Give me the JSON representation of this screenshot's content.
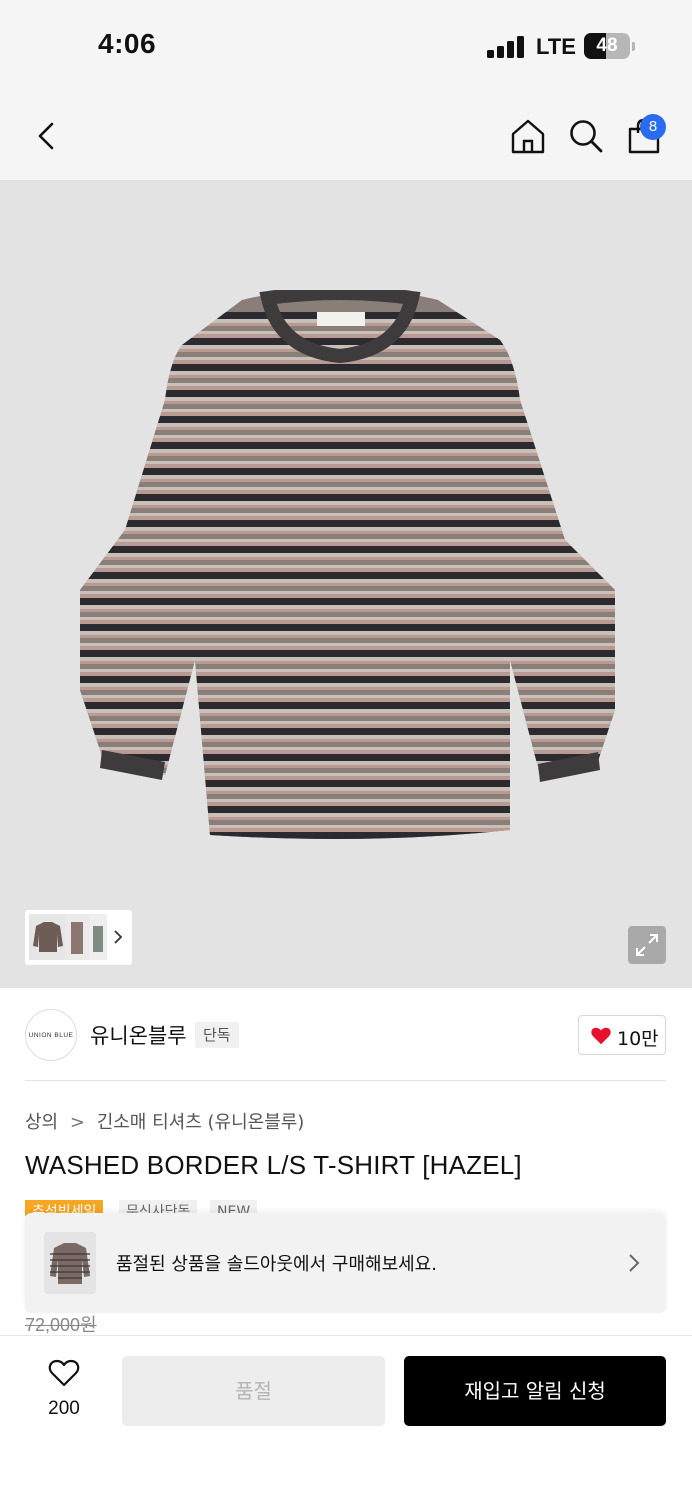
{
  "status_bar": {
    "time": "4:06",
    "network": "LTE",
    "battery": "48",
    "battery_level": 0.48
  },
  "header": {
    "back_icon": "chevron-left-icon",
    "home_icon": "home-icon",
    "search_icon": "search-icon",
    "cart_icon": "shopping-bag-icon",
    "cart_count": "8"
  },
  "gallery": {
    "image": "striped long-sleeve t-shirt",
    "shirt_colors": {
      "base": "#8a7e79",
      "dark_stripe": "#2b2a2f",
      "rose_stripe": "#b89a93",
      "light_stripe": "#c8bfb9",
      "rib": "#3d3b3c"
    },
    "expand_icon": "expand-icon",
    "thumb_more_icon": "chevron-right-icon"
  },
  "brand": {
    "logo_text": "UNION BLUE",
    "name": "유니온블루",
    "tag": "단독",
    "like_icon": "heart-icon",
    "like_count": "10만"
  },
  "breadcrumb": {
    "category": "상의",
    "separator": ">",
    "subcategory": "긴소매 티셔츠 (유니온블루)"
  },
  "product": {
    "title": "WASHED BORDER L/S T-SHIRT [HAZEL]",
    "tags": [
      "추석빅세일",
      "무신사단독",
      "NEW"
    ],
    "original_price": "72,000원"
  },
  "soldout_banner": {
    "text": "품절된 상품을 솔드아웃에서 구매해보세요.",
    "arrow_icon": "chevron-right-icon"
  },
  "bottom_bar": {
    "wish_icon": "heart-outline-icon",
    "wish_count": "200",
    "soldout_label": "품절",
    "restock_label": "재입고 알림 신청"
  },
  "colors": {
    "accent_orange": "#f5a623",
    "badge_blue": "#2a6cf0",
    "primary_black": "#000000"
  }
}
